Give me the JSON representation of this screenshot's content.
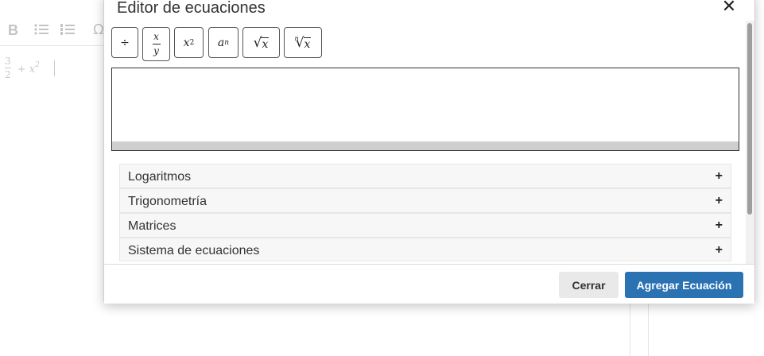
{
  "background_editor": {
    "toolbar": {
      "bold_label": "B",
      "special_char_label": "Ω"
    },
    "content": {
      "fraction_numerator": "3",
      "fraction_denominator": "2",
      "expression": "+ x",
      "exponent": "2"
    }
  },
  "modal": {
    "title": "Editor de ecuaciones",
    "close_label": "✕",
    "math_buttons": [
      {
        "name": "division",
        "label": "÷"
      },
      {
        "name": "fraction",
        "numerator": "x",
        "denominator": "y"
      },
      {
        "name": "square",
        "base": "x",
        "exponent": "2"
      },
      {
        "name": "power",
        "base": "a",
        "exponent": "n"
      },
      {
        "name": "square-root",
        "radicand": "x"
      },
      {
        "name": "nth-root",
        "index": "n",
        "radicand": "x"
      }
    ],
    "sections": [
      {
        "label": "Logaritmos",
        "toggle": "+"
      },
      {
        "label": "Trigonometría",
        "toggle": "+"
      },
      {
        "label": "Matrices",
        "toggle": "+"
      },
      {
        "label": "Sistema de ecuaciones",
        "toggle": "+"
      }
    ],
    "footer": {
      "cancel_label": "Cerrar",
      "submit_label": "Agregar Ecuación"
    }
  },
  "colors": {
    "primary_button": "#2b72b3",
    "secondary_button": "#e9e9e9",
    "section_background": "#f7f7f7"
  }
}
